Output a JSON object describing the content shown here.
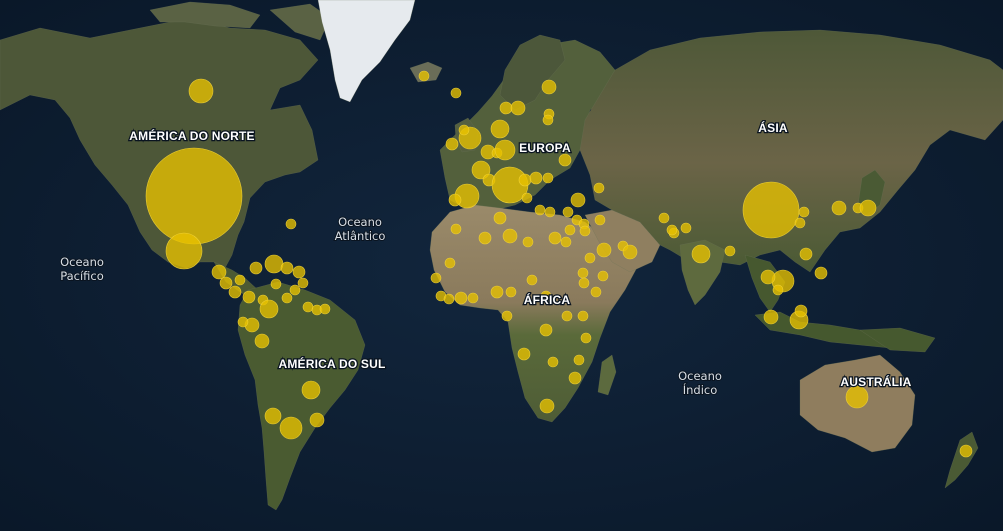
{
  "map": {
    "continent_labels": [
      {
        "id": "north-america",
        "text": "AMÉRICA DO NORTE"
      },
      {
        "id": "europe",
        "text": "EUROPA"
      },
      {
        "id": "asia",
        "text": "ÁSIA"
      },
      {
        "id": "africa",
        "text": "ÁFRICA"
      },
      {
        "id": "south-america",
        "text": "AMÉRICA DO SUL"
      },
      {
        "id": "australia",
        "text": "AUSTRÁLIA"
      }
    ],
    "ocean_labels": [
      {
        "id": "pacific",
        "line1": "Oceano",
        "line2": "Pacífico"
      },
      {
        "id": "atlantic",
        "line1": "Oceano",
        "line2": "Atlântico"
      },
      {
        "id": "indian",
        "line1": "Oceano",
        "line2": "Índico"
      }
    ],
    "colors": {
      "ocean": "#0d1f33",
      "land": "#4f5a3a",
      "land_dark": "#3d4630",
      "desert": "#8d8064",
      "ice": "#e8ecef",
      "bubble": "#e8c200"
    }
  }
}
